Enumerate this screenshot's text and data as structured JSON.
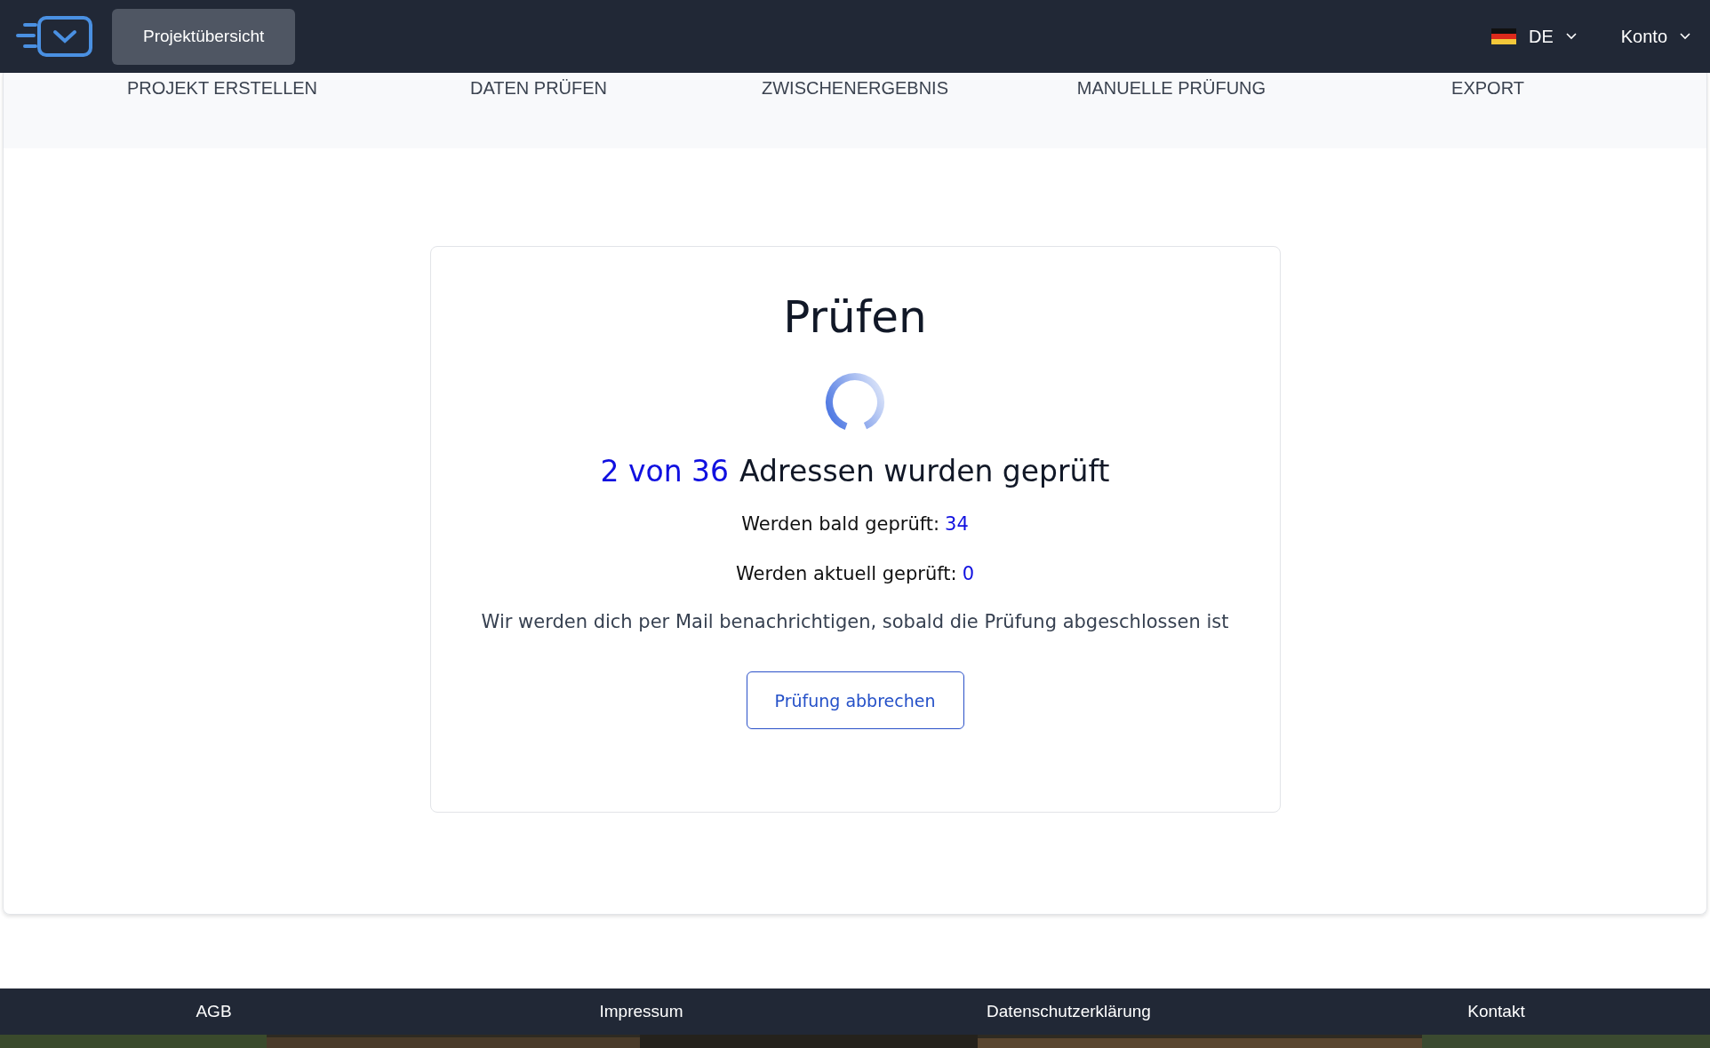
{
  "header": {
    "nav_button": "Projektübersicht",
    "language": "DE",
    "account": "Konto"
  },
  "steps": [
    {
      "label": "PROJEKT ERSTELLEN"
    },
    {
      "label": "DATEN PRÜFEN"
    },
    {
      "label": "ZWISCHENERGEBNIS"
    },
    {
      "label": "MANUELLE PRÜFUNG"
    },
    {
      "label": "EXPORT"
    }
  ],
  "card": {
    "title": "Prüfen",
    "progress_count": "2 von 36",
    "progress_text": "Adressen wurden geprüft",
    "stats": [
      {
        "label": "Werden bald geprüft:",
        "value": "34"
      },
      {
        "label": "Werden aktuell geprüft:",
        "value": "0"
      }
    ],
    "notice": "Wir werden dich per Mail benachrichtigen, sobald die Prüfung abgeschlossen ist",
    "cancel_button": "Prüfung abbrechen"
  },
  "footer": {
    "links": [
      "AGB",
      "Impressum",
      "Datenschutzerklärung",
      "Kontakt"
    ]
  }
}
